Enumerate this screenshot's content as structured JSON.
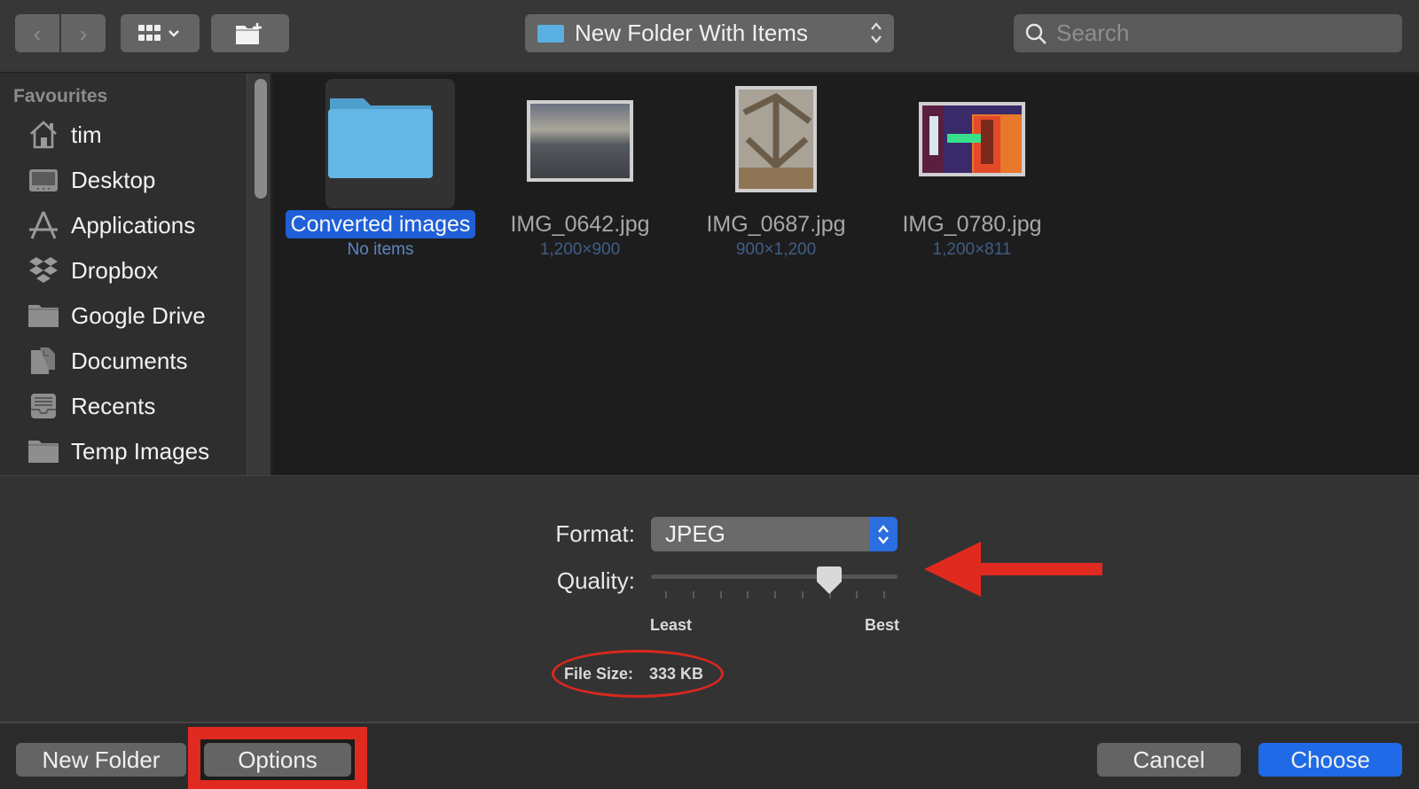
{
  "toolbar": {
    "back_icon": "chevron-left-icon",
    "forward_icon": "chevron-right-icon",
    "view_icon": "grid-view-icon",
    "new_folder_icon": "new-folder-icon",
    "location": "New Folder With Items",
    "search_placeholder": "Search",
    "search_value": ""
  },
  "sidebar": {
    "section": "Favourites",
    "items": [
      {
        "label": "tim",
        "icon": "home-icon"
      },
      {
        "label": "Desktop",
        "icon": "desktop-icon"
      },
      {
        "label": "Applications",
        "icon": "applications-icon"
      },
      {
        "label": "Dropbox",
        "icon": "dropbox-icon"
      },
      {
        "label": "Google Drive",
        "icon": "folder-icon"
      },
      {
        "label": "Documents",
        "icon": "documents-icon"
      },
      {
        "label": "Recents",
        "icon": "recents-icon"
      },
      {
        "label": "Temp Images",
        "icon": "folder-icon"
      }
    ]
  },
  "files": [
    {
      "name": "Converted images",
      "meta": "No items",
      "type": "folder",
      "selected": true
    },
    {
      "name": "IMG_0642.jpg",
      "meta": "1,200×900",
      "type": "image",
      "selected": false
    },
    {
      "name": "IMG_0687.jpg",
      "meta": "900×1,200",
      "type": "image",
      "selected": false
    },
    {
      "name": "IMG_0780.jpg",
      "meta": "1,200×811",
      "type": "image",
      "selected": false
    }
  ],
  "options": {
    "format_label": "Format:",
    "format_value": "JPEG",
    "quality_label": "Quality:",
    "quality_fraction": 0.75,
    "quality_ticks": 9,
    "quality_min_label": "Least",
    "quality_max_label": "Best",
    "file_size_label": "File Size:",
    "file_size_value": "333 KB"
  },
  "annotations": {
    "color": "#e02a1f",
    "arrow_target": "quality-slider",
    "circle_target": "file-size",
    "box_target": "options-button"
  },
  "footer": {
    "new_folder": "New Folder",
    "options": "Options",
    "cancel": "Cancel",
    "choose": "Choose"
  },
  "colors": {
    "accent": "#1f6ae6",
    "folder": "#5ab0e0"
  }
}
